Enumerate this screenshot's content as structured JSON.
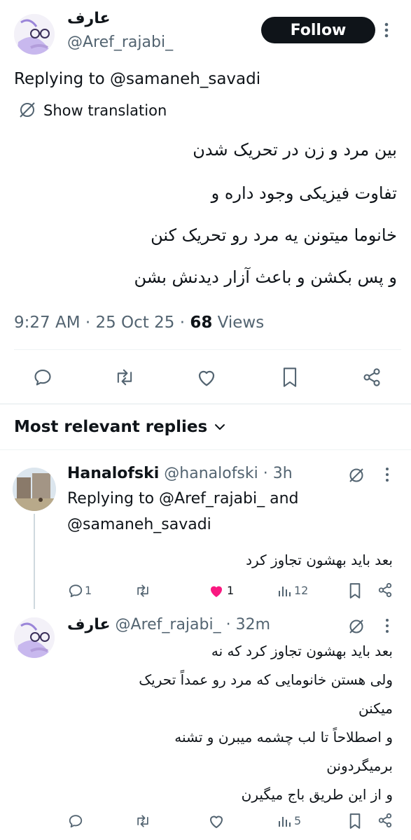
{
  "author": {
    "display_name": "عارف",
    "handle": "@Aref_rajabi_",
    "follow_label": "Follow"
  },
  "main_tweet": {
    "replying_to": "Replying to @samaneh_savadi",
    "translate_label": "Show translation",
    "lines": [
      "بین مرد و زن در تحریک شدن",
      "تفاوت فیزیکی وجود داره و",
      "خانوما میتونن یه مرد رو تحریک کنن",
      "و پس بکشن و باعث آزار دیدنش بشن"
    ],
    "meta_time": "9:27 AM · 25 Oct 25 · ",
    "views_count": "68",
    "views_label": " Views"
  },
  "actions": [
    "reply-icon",
    "retweet-icon",
    "like-icon",
    "bookmark-icon",
    "share-icon"
  ],
  "replies_header": {
    "label": "Most relevant replies"
  },
  "reply1": {
    "display_name": "Hanalofski",
    "handle_time": "@hanalofski · 3h",
    "replying_line1": "Replying to @Aref_rajabi_ and",
    "replying_line2": "@samaneh_savadi",
    "text": "بعد باید بهشون تجاوز کرد",
    "replies": "1",
    "likes": "1",
    "views": "12",
    "like_color": "#f91880"
  },
  "reply2": {
    "display_name": "عارف",
    "handle_time": "@Aref_rajabi_ · 32m",
    "lines": [
      "بعد باید بهشون تجاوز کرد که نه",
      "ولی هستن خانومایی که مرد رو عمداً تحریک",
      "میکنن",
      "و اصطلاحاً تا لب چشمه میبرن و تشنه",
      "برمیگردونن",
      "و از این طریق باج میگیرن"
    ],
    "views": "5"
  }
}
